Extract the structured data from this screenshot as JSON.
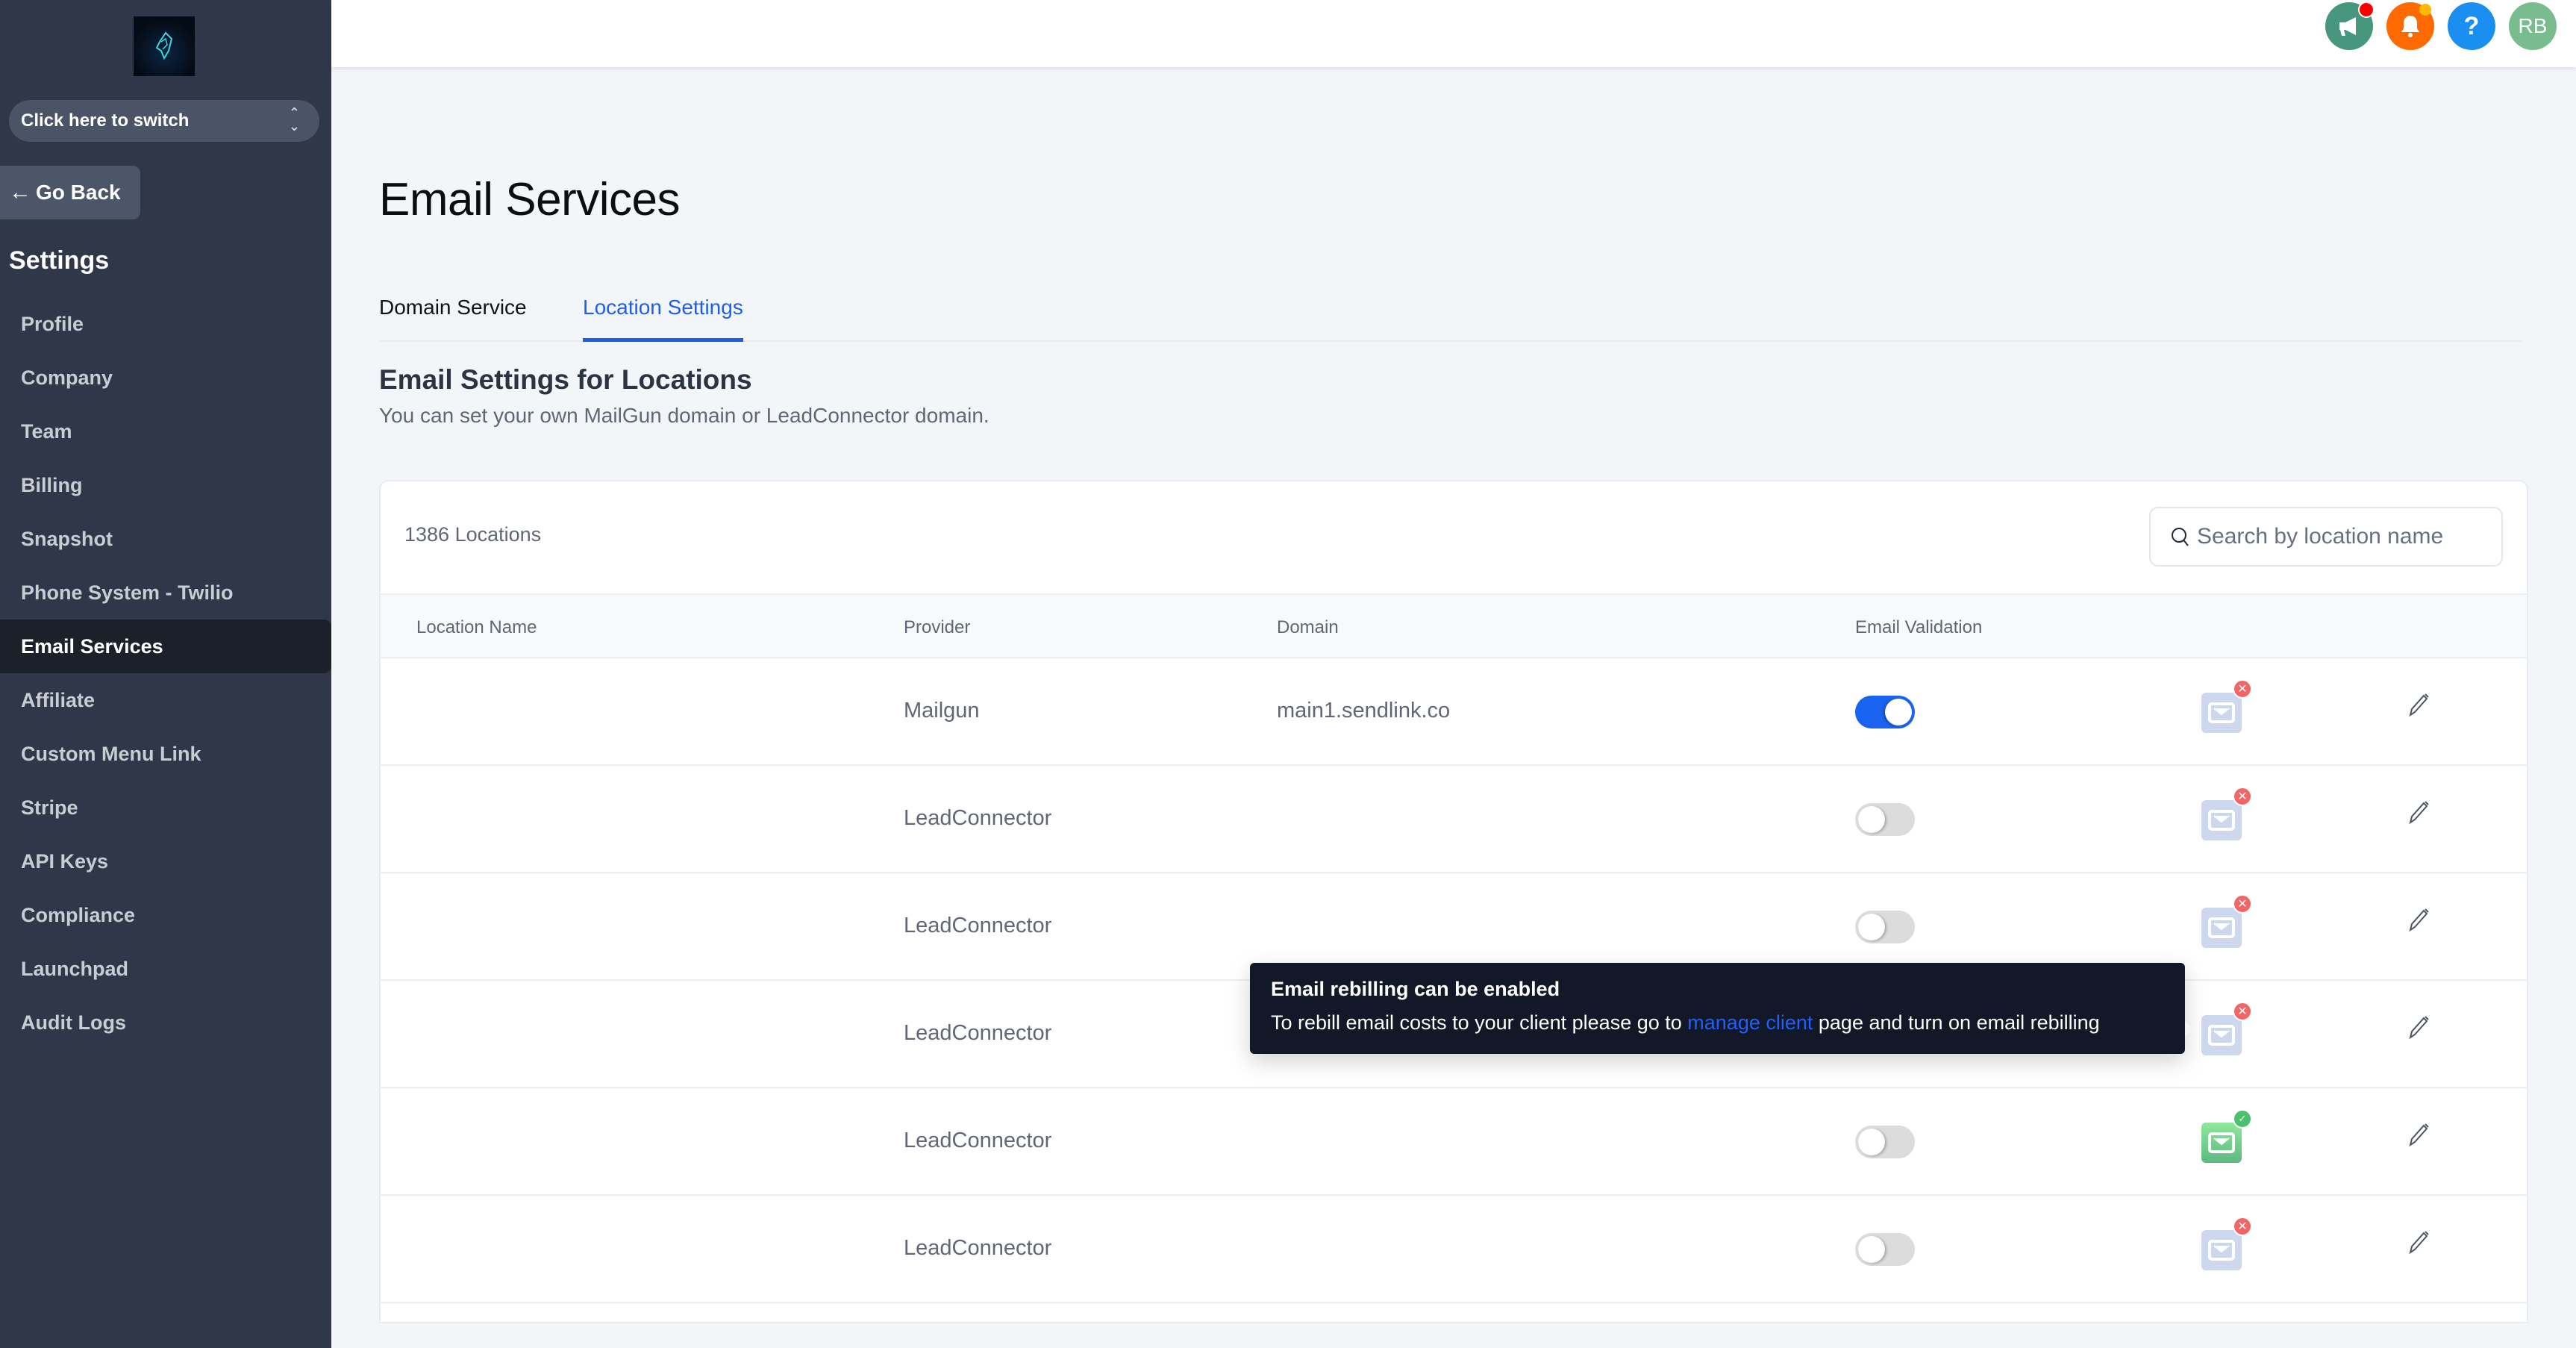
{
  "sidebar": {
    "logo_alt": "Lion logo",
    "switcher_label": "Click here to switch",
    "go_back_label": "Go Back",
    "section_title": "Settings",
    "items": [
      {
        "label": "Profile",
        "active": false
      },
      {
        "label": "Company",
        "active": false
      },
      {
        "label": "Team",
        "active": false
      },
      {
        "label": "Billing",
        "active": false
      },
      {
        "label": "Snapshot",
        "active": false
      },
      {
        "label": "Phone System - Twilio",
        "active": false
      },
      {
        "label": "Email Services",
        "active": true
      },
      {
        "label": "Affiliate",
        "active": false
      },
      {
        "label": "Custom Menu Link",
        "active": false
      },
      {
        "label": "Stripe",
        "active": false
      },
      {
        "label": "API Keys",
        "active": false
      },
      {
        "label": "Compliance",
        "active": false
      },
      {
        "label": "Launchpad",
        "active": false
      },
      {
        "label": "Audit Logs",
        "active": false
      }
    ]
  },
  "header": {
    "icons": [
      {
        "name": "megaphone-icon",
        "color": "#47967e",
        "badge_color": "#ff0000"
      },
      {
        "name": "bell-icon",
        "color": "#ff6a00",
        "badge_color": "#ffb800"
      },
      {
        "name": "help-icon",
        "color": "#1b8ef2",
        "glyph": "?"
      },
      {
        "name": "avatar",
        "color": "#79bd8f",
        "initials": "RB"
      }
    ]
  },
  "main": {
    "page_title": "Email Services",
    "tabs": [
      {
        "label": "Domain Service",
        "active": false
      },
      {
        "label": "Location Settings",
        "active": true
      }
    ],
    "section_title": "Email Settings for Locations",
    "section_subtitle": "You can set your own MailGun domain or LeadConnector domain.",
    "locations_count": "1386 Locations",
    "search": {
      "placeholder": "Search by location name",
      "value": ""
    },
    "table": {
      "columns": [
        "Location Name",
        "Provider",
        "Domain",
        "Email Validation",
        "",
        ""
      ],
      "rows": [
        {
          "location_name": "",
          "provider": "Mailgun",
          "domain": "main1.sendlink.co",
          "email_validation": true,
          "rebilling_status": "disabled"
        },
        {
          "location_name": "",
          "provider": "LeadConnector",
          "domain": "",
          "email_validation": false,
          "rebilling_status": "disabled"
        },
        {
          "location_name": "",
          "provider": "LeadConnector",
          "domain": "",
          "email_validation": false,
          "rebilling_status": "disabled"
        },
        {
          "location_name": "",
          "provider": "LeadConnector",
          "domain": "",
          "email_validation": false,
          "rebilling_status": "disabled"
        },
        {
          "location_name": "",
          "provider": "LeadConnector",
          "domain": "",
          "email_validation": false,
          "rebilling_status": "enabled"
        },
        {
          "location_name": "",
          "provider": "LeadConnector",
          "domain": "",
          "email_validation": false,
          "rebilling_status": "disabled"
        }
      ]
    }
  },
  "tooltip": {
    "title": "Email rebilling can be enabled",
    "body_before": "To rebill email costs to your client please go to ",
    "link_text": "manage client",
    "body_after": " page and turn on email rebilling"
  },
  "colors": {
    "accent": "#1e5eeb",
    "toggle_on": "#1a62f0",
    "sidebar_bg": "#2f3749",
    "status_error": "#f16565",
    "status_ok": "#4cc06e"
  }
}
